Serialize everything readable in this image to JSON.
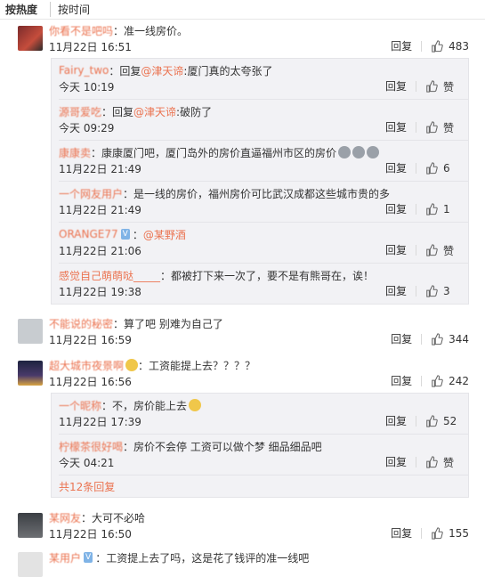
{
  "tabs": {
    "hot": "按热度",
    "time": "按时间"
  },
  "labels": {
    "reply": "回复",
    "like": "赞",
    "more": "共12条回复"
  },
  "comments": [
    {
      "name": "你看不是吧吗",
      "text": "：准一线房价。",
      "time": "11月22日 16:51",
      "likes": "483",
      "replies": [
        {
          "name": "Fairy_two",
          "link": "@津天谛",
          "text": ":厦门真的太夸张了",
          "prefix": "：回复",
          "time": "今天 10:19",
          "likes": "赞"
        },
        {
          "name": "源哥爱吃",
          "link": "@津天谛",
          "text": ":破防了",
          "prefix": "：回复",
          "time": "今天 09:29",
          "likes": "赞"
        },
        {
          "name": "康康卖",
          "text": "：康康厦门吧，厦门岛外的房价直逼福州市区的房价",
          "time": "11月22日 21:49",
          "likes": "6"
        },
        {
          "name": "一个网友用户",
          "text": "：是一线的房价，福州房价可比武汉成都这些城市贵的多",
          "time": "11月22日 21:49",
          "likes": "1"
        },
        {
          "name": "ORANGE77",
          "link": "@某野酒",
          "text": "",
          "prefix": "：",
          "time": "11月22日 21:06",
          "likes": "赞"
        },
        {
          "name": "感觉自己萌萌哒_____",
          "text": "：都被打下来一次了，要不是有熊哥在，诶！",
          "time": "11月22日 19:38",
          "likes": "3"
        }
      ]
    },
    {
      "name": "不能说的秘密",
      "text": "：算了吧 别难为自己了",
      "time": "11月22日 16:59",
      "likes": "344"
    },
    {
      "name": "超大城市夜景啊",
      "text": "：工资能提上去？？？？",
      "time": "11月22日 16:56",
      "likes": "242",
      "replies": [
        {
          "name": "一个昵称",
          "text": "：不，房价能上去",
          "time": "11月22日 17:39",
          "likes": "52"
        },
        {
          "name": "柠檬茶很好喝",
          "text": "：房价不会停 工资可以做个梦 细品细品吧",
          "time": "今天 04:21",
          "likes": "赞"
        }
      ]
    },
    {
      "name": "某网友",
      "text": "：大可不必哈",
      "time": "11月22日 16:50",
      "likes": "155"
    },
    {
      "name": "某用户",
      "text": "：工资提上去了吗，这是花了钱评的准一线吧"
    }
  ]
}
